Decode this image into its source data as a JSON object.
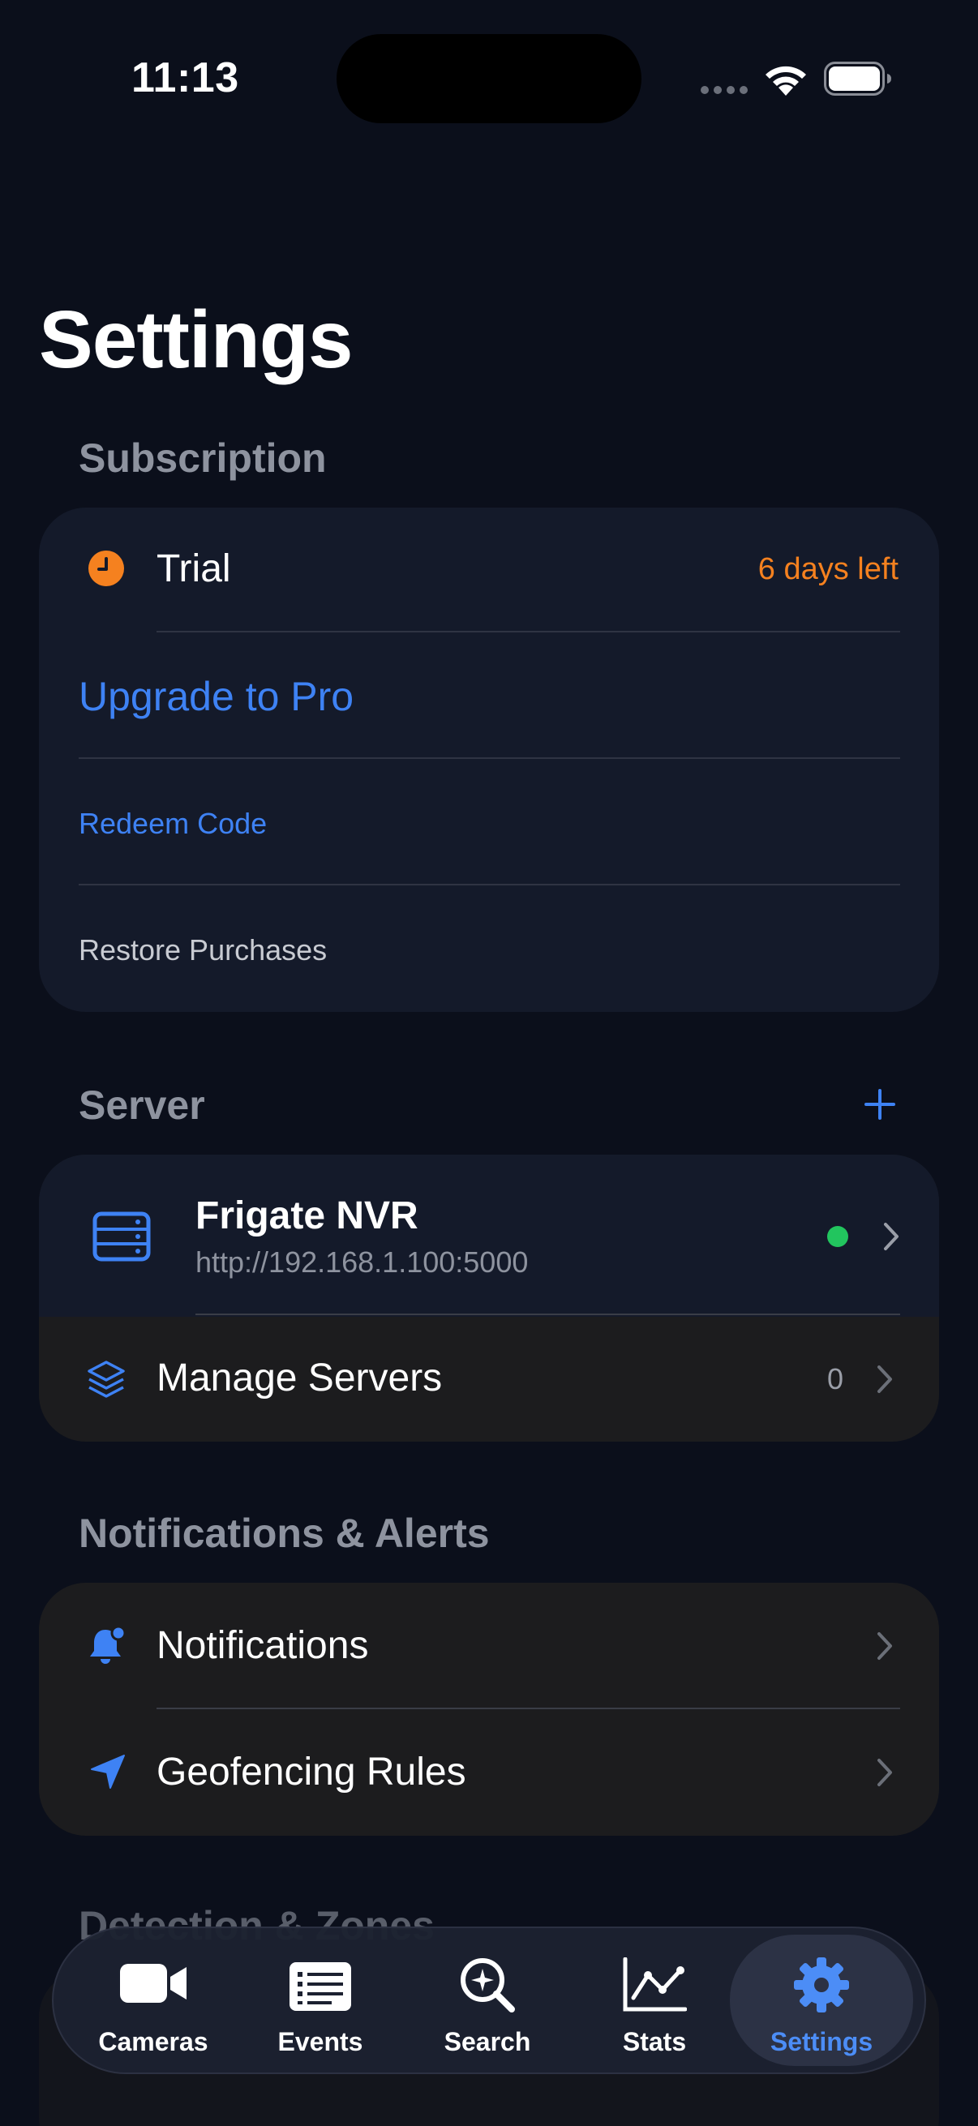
{
  "status_bar": {
    "time": "11:13"
  },
  "page": {
    "title": "Settings"
  },
  "subscription": {
    "header": "Subscription",
    "trial_label": "Trial",
    "trial_remaining": "6 days left",
    "upgrade_label": "Upgrade to Pro",
    "redeem_label": "Redeem Code",
    "restore_label": "Restore Purchases"
  },
  "server": {
    "header": "Server",
    "add_icon": "plus-icon",
    "current": {
      "name": "Frigate NVR",
      "url": "http://192.168.1.100:5000",
      "status_color": "#22c55e"
    },
    "manage_label": "Manage Servers",
    "manage_count": "0"
  },
  "notifications": {
    "header": "Notifications & Alerts",
    "items": [
      {
        "label": "Notifications",
        "icon": "bell-icon"
      },
      {
        "label": "Geofencing Rules",
        "icon": "location-arrow-icon"
      }
    ]
  },
  "partial": {
    "header": "Detection & Zones"
  },
  "tabbar": {
    "tabs": [
      {
        "label": "Cameras",
        "icon": "video-camera-icon"
      },
      {
        "label": "Events",
        "icon": "list-icon"
      },
      {
        "label": "Search",
        "icon": "search-icon"
      },
      {
        "label": "Stats",
        "icon": "chart-icon"
      },
      {
        "label": "Settings",
        "icon": "gear-icon",
        "active": true
      }
    ]
  },
  "colors": {
    "accent": "#3e82f4",
    "warning": "#f5811f",
    "background": "#0b0f1b",
    "card": "#141a2a"
  }
}
